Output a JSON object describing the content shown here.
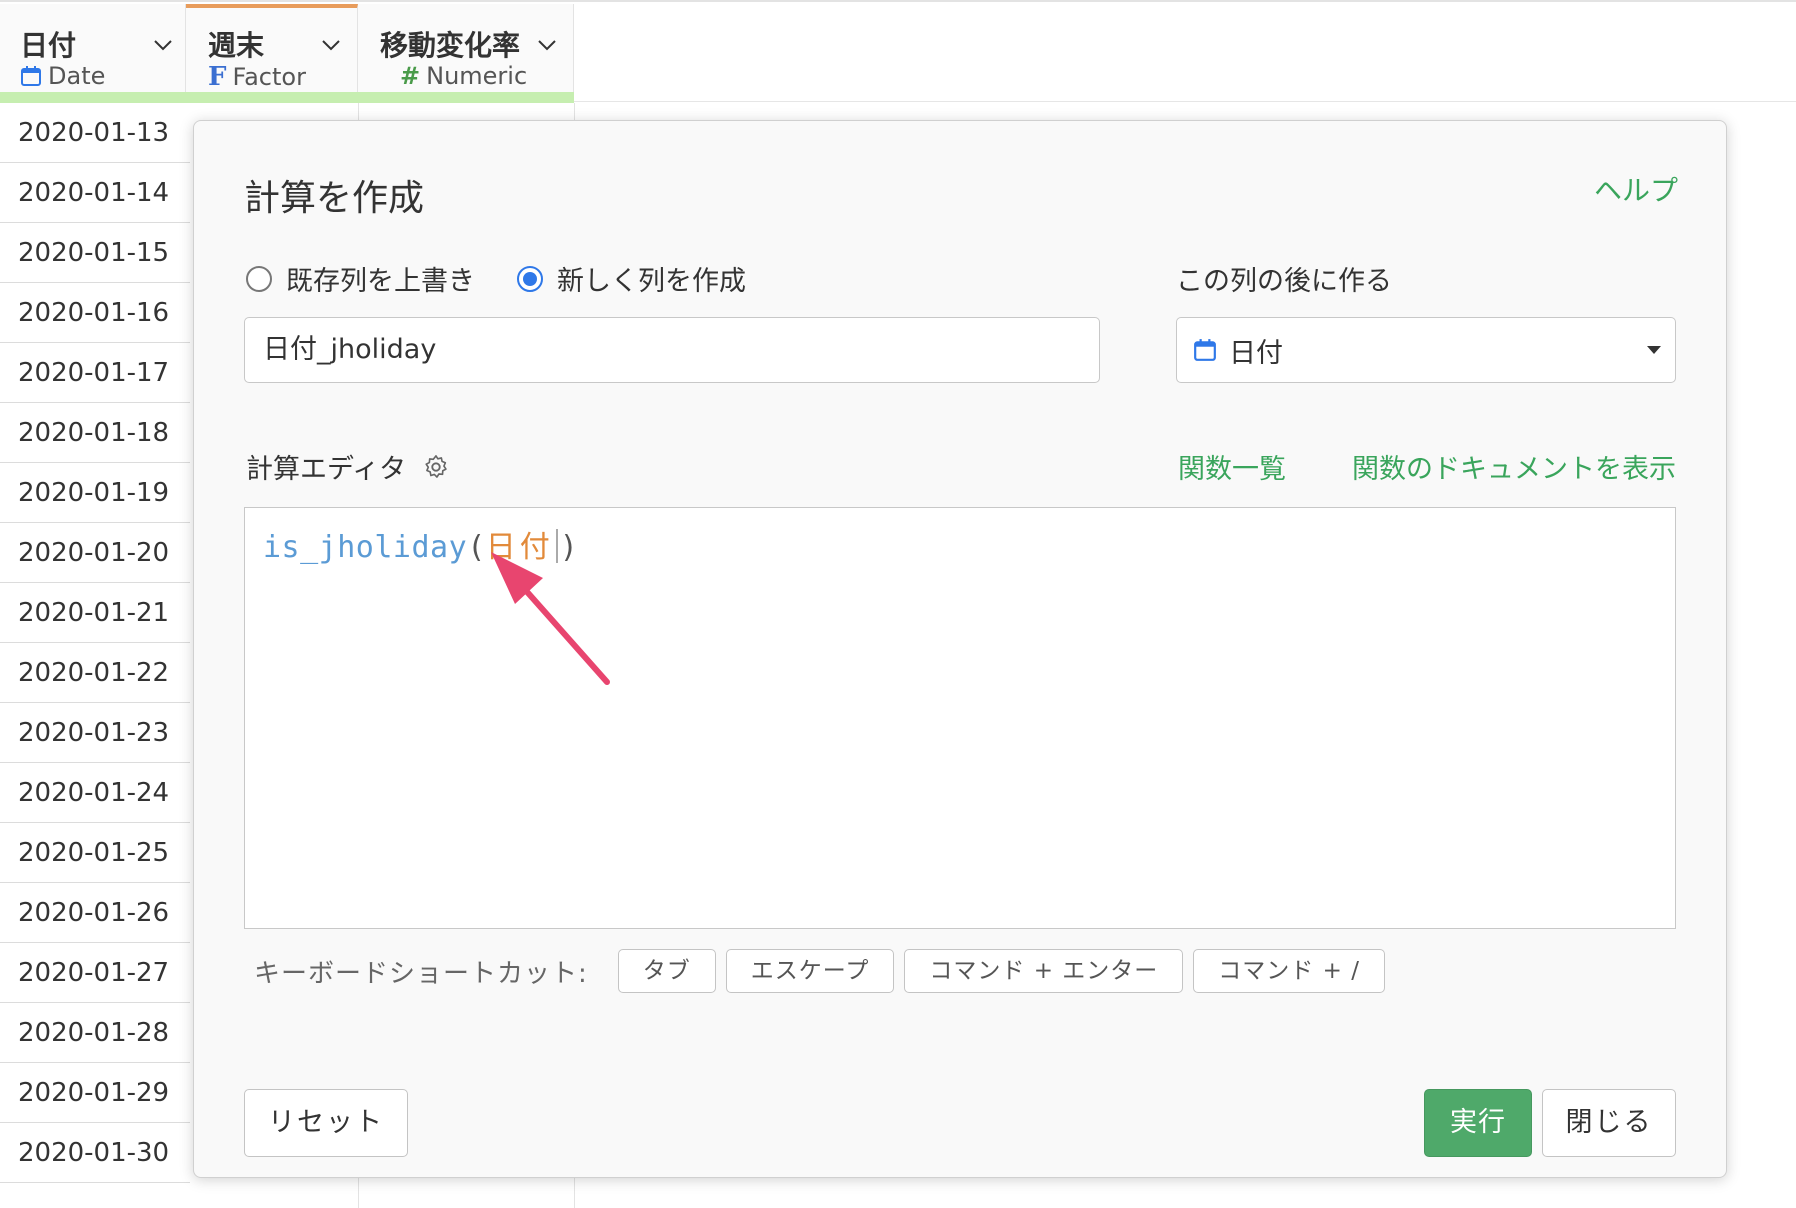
{
  "table": {
    "columns": [
      {
        "title": "日付",
        "type_label": "Date",
        "type_icon": "calendar-icon"
      },
      {
        "title": "週末",
        "type_label": "Factor",
        "type_icon": "factor-icon",
        "type_glyph": "F"
      },
      {
        "title": "移動変化率",
        "type_label": "Numeric",
        "type_icon": "numeric-icon",
        "type_glyph": "#"
      }
    ],
    "rows": [
      "2020-01-13",
      "2020-01-14",
      "2020-01-15",
      "2020-01-16",
      "2020-01-17",
      "2020-01-18",
      "2020-01-19",
      "2020-01-20",
      "2020-01-21",
      "2020-01-22",
      "2020-01-23",
      "2020-01-24",
      "2020-01-25",
      "2020-01-26",
      "2020-01-27",
      "2020-01-28",
      "2020-01-29",
      "2020-01-30"
    ],
    "colors": {
      "factor_accent": "#e89c5b",
      "header_highlight": "#c6eeb0"
    }
  },
  "dialog": {
    "title": "計算を作成",
    "help_link": "ヘルプ",
    "radio_overwrite": "既存列を上書き",
    "radio_new": "新しく列を作成",
    "selected_mode": "new",
    "after_label": "この列の後に作る",
    "new_column_name": "日付_jholiday",
    "after_column": "日付",
    "editor_label": "計算エディタ",
    "function_list_link": "関数一覧",
    "function_doc_link": "関数のドキュメントを表示",
    "code": {
      "function": "is_jholiday",
      "open": "(",
      "argument": "日付",
      "close": ")"
    },
    "shortcut_label": "キーボードショートカット:",
    "shortcuts": [
      "タブ",
      "エスケープ",
      "コマンド + エンター",
      "コマンド + /"
    ],
    "reset_button": "リセット",
    "run_button": "実行",
    "close_button": "閉じる",
    "colors": {
      "accent_green": "#4fa96a",
      "link_green": "#3aa55c",
      "radio_blue": "#2f78e8",
      "code_function": "#5b9bd5",
      "code_argument": "#e28a3a",
      "annotation_arrow": "#e8456f"
    }
  }
}
